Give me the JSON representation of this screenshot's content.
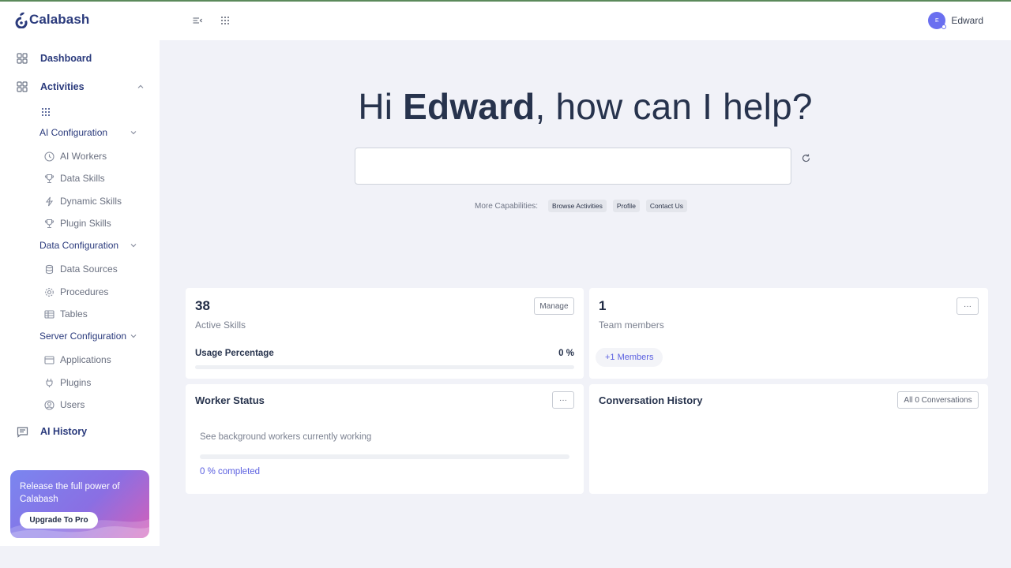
{
  "app": {
    "name": "Calabash"
  },
  "sidebar": {
    "dashboard": "Dashboard",
    "activities": "Activities",
    "ai_configuration": {
      "label": "AI Configuration",
      "items": [
        {
          "label": "AI Workers",
          "icon": "clock-icon"
        },
        {
          "label": "Data Skills",
          "icon": "trophy-icon"
        },
        {
          "label": "Dynamic Skills",
          "icon": "bolt-icon"
        },
        {
          "label": "Plugin Skills",
          "icon": "trophy-icon"
        }
      ]
    },
    "data_configuration": {
      "label": "Data Configuration",
      "items": [
        {
          "label": "Data Sources",
          "icon": "database-icon"
        },
        {
          "label": "Procedures",
          "icon": "gear-icon"
        },
        {
          "label": "Tables",
          "icon": "table-icon"
        }
      ]
    },
    "server_configuration": {
      "label": "Server Configuration",
      "items": [
        {
          "label": "Applications",
          "icon": "window-icon"
        },
        {
          "label": "Plugins",
          "icon": "plug-icon"
        },
        {
          "label": "Users",
          "icon": "user-icon"
        }
      ]
    },
    "ai_history": "AI History",
    "promo": {
      "text": "Release the full power of Calabash",
      "button": "Upgrade To Pro"
    }
  },
  "header": {
    "user_name": "Edward",
    "avatar_initial": "E"
  },
  "hero": {
    "greeting": "Hi",
    "name": "Edward",
    "rest": ", how can I help?",
    "prompt_value": "",
    "capabilities_label": "More Capabilities:",
    "chips": [
      "Browse Activities",
      "Profile",
      "Contact Us"
    ]
  },
  "skills_card": {
    "count": "38",
    "label": "Active Skills",
    "manage": "Manage",
    "usage_label": "Usage Percentage",
    "usage_value": "0 %",
    "usage_fraction": 0
  },
  "team_card": {
    "count": "1",
    "label": "Team members",
    "more": "···",
    "members_button": "+1 Members"
  },
  "worker_card": {
    "title": "Worker Status",
    "more": "···",
    "description": "See background workers currently working",
    "progress_text": "0 % completed",
    "progress_fraction": 0
  },
  "history_card": {
    "title": "Conversation History",
    "button": "All 0 Conversations"
  },
  "colors": {
    "accent": "#6a6ff0",
    "brand": "#2a3a7c"
  }
}
